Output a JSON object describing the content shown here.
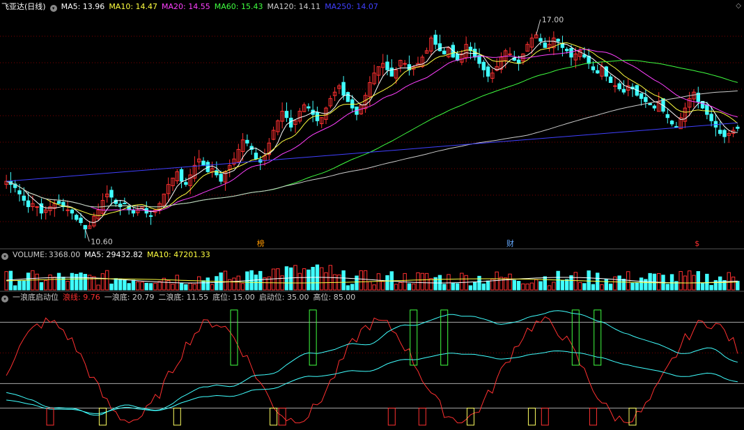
{
  "main_header": {
    "title": "飞亚达(日线)",
    "items": [
      {
        "label": "MA5:",
        "value": "13.96",
        "color": "#ffffff"
      },
      {
        "label": "MA10:",
        "value": "14.47",
        "color": "#ffff40"
      },
      {
        "label": "MA20:",
        "value": "14.55",
        "color": "#ff40ff"
      },
      {
        "label": "MA60:",
        "value": "15.43",
        "color": "#40ff40"
      },
      {
        "label": "MA120:",
        "value": "14.11",
        "color": "#cccccc"
      },
      {
        "label": "MA250:",
        "value": "14.07",
        "color": "#4040ff"
      }
    ]
  },
  "volume_header": {
    "title": "VOLUME:",
    "value": "3368.00",
    "items": [
      {
        "label": "MA5:",
        "value": "29432.82",
        "color": "#ffffff"
      },
      {
        "label": "MA10:",
        "value": "47201.33",
        "color": "#ffff40"
      }
    ]
  },
  "indicator_header": {
    "title": "一浪底启动位",
    "items": [
      {
        "label": "浪线:",
        "value": "9.76",
        "color": "#ff3030"
      },
      {
        "label": "一浪底:",
        "value": "20.79",
        "color": "#cccccc"
      },
      {
        "label": "二浪底:",
        "value": "11.55",
        "color": "#cccccc"
      },
      {
        "label": "底位:",
        "value": "15.00",
        "color": "#cccccc"
      },
      {
        "label": "启动位:",
        "value": "35.00",
        "color": "#cccccc"
      },
      {
        "label": "高位:",
        "value": "85.00",
        "color": "#cccccc"
      }
    ]
  },
  "annotations": {
    "high_label": "17.00",
    "low_label": "10.60",
    "markers": [
      {
        "text": "榜",
        "index": 58,
        "color": "#ff9900"
      },
      {
        "text": "财",
        "index": 115,
        "color": "#66aaff"
      },
      {
        "text": "$",
        "index": 158,
        "color": "#ff3030"
      }
    ]
  },
  "colors": {
    "up": "#ff3030",
    "down": "#40ffff",
    "grid": "#800000",
    "ma5": "#ffffff",
    "ma10": "#ffff40",
    "ma20": "#ff40ff",
    "ma60": "#40ff40",
    "ma120": "#cccccc",
    "ma250": "#4040ff"
  },
  "chart_data": {
    "type": "candlestick",
    "y_range": [
      10.2,
      17.6
    ],
    "closes": [
      12.3,
      12.2,
      12.1,
      11.9,
      11.7,
      11.5,
      11.6,
      11.5,
      11.3,
      11.4,
      11.5,
      11.6,
      11.6,
      11.5,
      11.4,
      11.3,
      11.1,
      11.0,
      10.8,
      10.9,
      11.2,
      11.4,
      11.7,
      11.9,
      11.8,
      11.6,
      11.5,
      11.6,
      11.4,
      11.3,
      11.4,
      11.5,
      11.3,
      11.2,
      11.4,
      11.6,
      11.9,
      12.2,
      12.4,
      12.6,
      12.3,
      12.2,
      12.5,
      12.8,
      13.0,
      12.8,
      12.6,
      12.7,
      12.5,
      12.3,
      12.6,
      12.8,
      13.0,
      13.3,
      13.6,
      13.5,
      13.3,
      13.0,
      12.9,
      13.1,
      13.5,
      13.9,
      14.2,
      14.5,
      14.3,
      14.0,
      14.2,
      14.5,
      14.7,
      14.6,
      14.4,
      14.2,
      14.3,
      14.6,
      14.9,
      15.1,
      15.3,
      15.0,
      14.8,
      14.6,
      14.4,
      14.7,
      15.0,
      15.4,
      15.7,
      15.9,
      16.0,
      15.8,
      15.6,
      15.8,
      16.1,
      16.0,
      15.8,
      15.9,
      16.0,
      16.2,
      16.4,
      16.8,
      16.6,
      16.4,
      16.3,
      16.5,
      16.2,
      16.1,
      16.3,
      16.6,
      16.4,
      16.2,
      16.0,
      15.8,
      15.6,
      15.7,
      15.9,
      16.2,
      16.4,
      16.3,
      16.1,
      16.0,
      16.3,
      16.6,
      16.8,
      16.9,
      16.7,
      16.5,
      16.6,
      16.8,
      16.7,
      16.5,
      16.4,
      16.2,
      16.3,
      16.4,
      16.2,
      16.0,
      15.8,
      15.7,
      15.9,
      15.6,
      15.4,
      15.3,
      15.2,
      15.1,
      15.3,
      15.2,
      15.0,
      14.9,
      14.8,
      14.7,
      14.6,
      14.8,
      14.5,
      14.3,
      14.1,
      14.0,
      14.3,
      14.6,
      14.9,
      15.1,
      14.8,
      14.6,
      14.4,
      14.2,
      14.0,
      13.8,
      13.7,
      13.8,
      13.9,
      13.96
    ]
  }
}
